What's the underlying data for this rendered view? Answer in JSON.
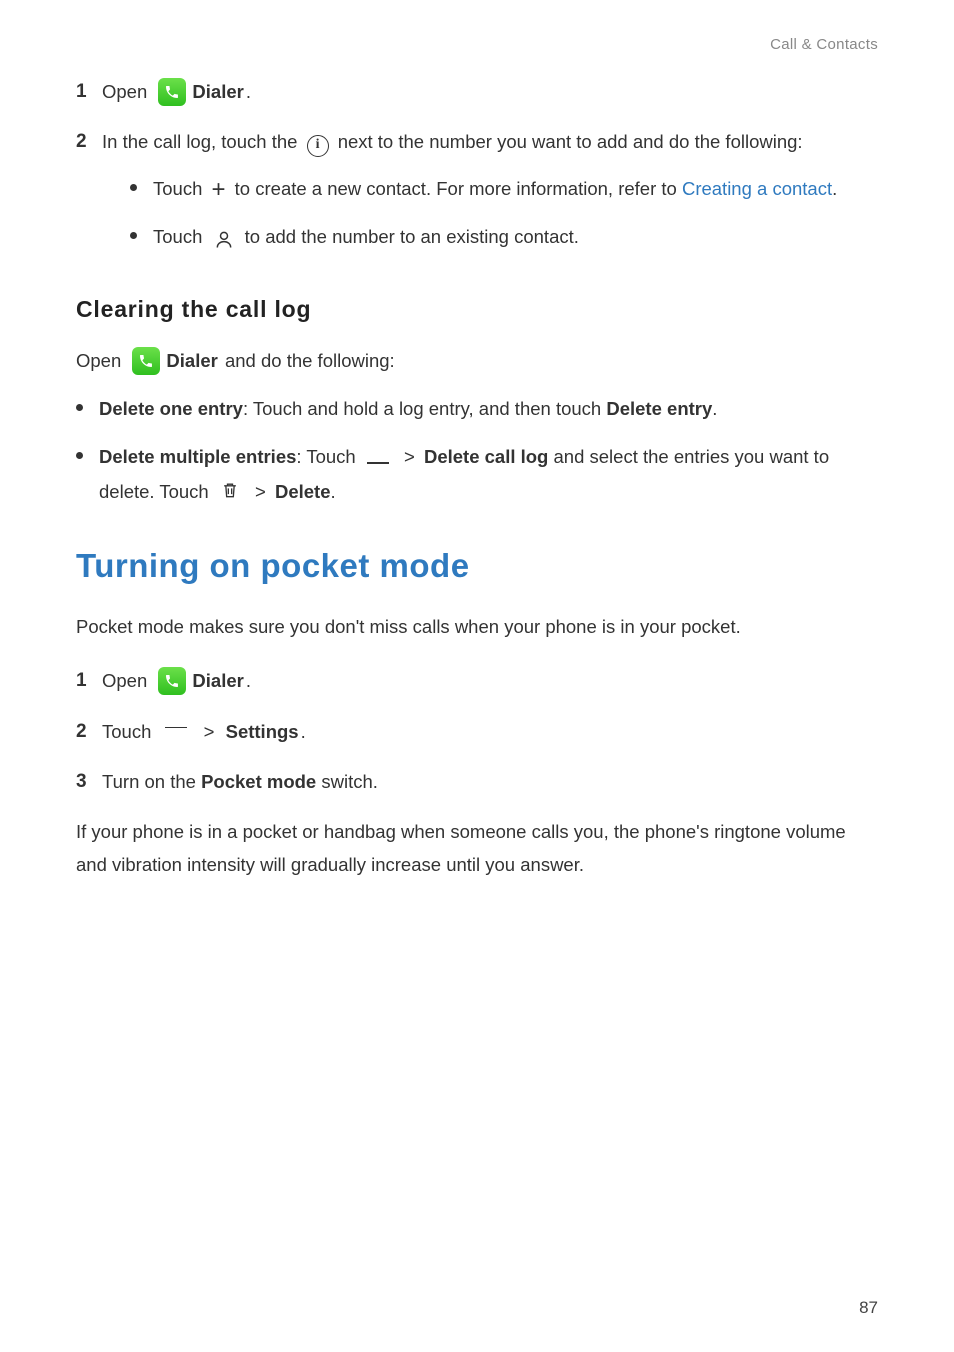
{
  "breadcrumb": "Call & Contacts",
  "step1": {
    "num": "1",
    "open": "Open ",
    "dialer": "Dialer",
    "period": "."
  },
  "step2": {
    "num": "2",
    "pre": "In the call log, touch the ",
    "post": " next to the number you want to add and do the following:",
    "b1_pre": "Touch ",
    "b1_mid": " to create a new contact. For more information, refer to ",
    "b1_link": "Creating a contact",
    "b1_end": ".",
    "b2_pre": "Touch ",
    "b2_post": " to add the number to an existing contact."
  },
  "clearing": {
    "heading": "Clearing the call log",
    "open": "Open ",
    "dialer": "Dialer",
    "after": " and do the following:",
    "b1_label": "Delete one entry",
    "b1_text": ": Touch and hold a log entry, and then touch ",
    "b1_bold": "Delete entry",
    "b1_end": ".",
    "b2_label": "Delete multiple entries",
    "b2_text1": ": Touch ",
    "b2_gt1": " > ",
    "b2_bold1": "Delete call log",
    "b2_text2": " and select the entries you want to delete. Touch ",
    "b2_gt2": " > ",
    "b2_bold2": "Delete",
    "b2_end": "."
  },
  "pocket": {
    "heading": "Turning on pocket mode",
    "intro": "Pocket mode makes sure you don't miss calls when your phone is in your pocket.",
    "s1_num": "1",
    "s1_open": "Open ",
    "s1_dialer": "Dialer",
    "s1_end": ".",
    "s2_num": "2",
    "s2_touch": "Touch ",
    "s2_gt": " > ",
    "s2_bold": "Settings",
    "s2_end": ".",
    "s3_num": "3",
    "s3_pre": "Turn on the ",
    "s3_bold": "Pocket mode",
    "s3_post": " switch.",
    "outro": "If your phone is in a pocket or handbag when someone calls you, the phone's ringtone volume and vibration intensity will gradually increase until you answer."
  },
  "page_number": "87"
}
